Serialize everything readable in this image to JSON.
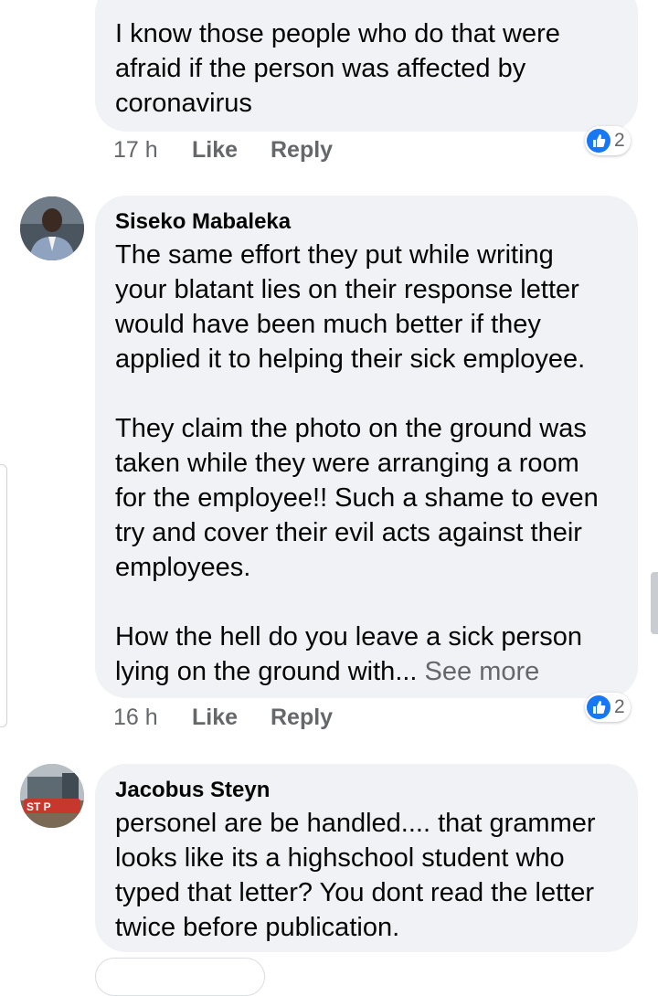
{
  "comments": [
    {
      "author": "",
      "text": "I know those people who do that were\nafraid if the person was affected by\ncoronavirus",
      "time": "17 h",
      "like_label": "Like",
      "reply_label": "Reply",
      "reaction_count": "2"
    },
    {
      "author": "Siseko Mabaleka",
      "text": "The same effort they put while writing\nyour blatant lies on their response letter\nwould have been much better if they\napplied it to helping their sick employee.\n\nThey claim the photo on the ground was\ntaken while they were arranging a room\nfor the employee!! Such a shame to even\ntry and cover their evil acts against their\nemployees.\n\nHow the hell do you leave a sick person\nlying on the ground with... ",
      "see_more": "See more",
      "time": "16 h",
      "like_label": "Like",
      "reply_label": "Reply",
      "reaction_count": "2"
    },
    {
      "author": "Jacobus Steyn",
      "avatar_text": "ST  P",
      "text": "personel are be handled.... that grammer\nlooks like its a highschool student who\ntyped that letter? You dont read the letter\ntwice before publication."
    }
  ],
  "icons": {
    "like_reaction": "thumbs-up-icon"
  },
  "colors": {
    "bubble": "#f0f2f5",
    "meta": "#65676b",
    "like_blue": "#1877f2"
  }
}
